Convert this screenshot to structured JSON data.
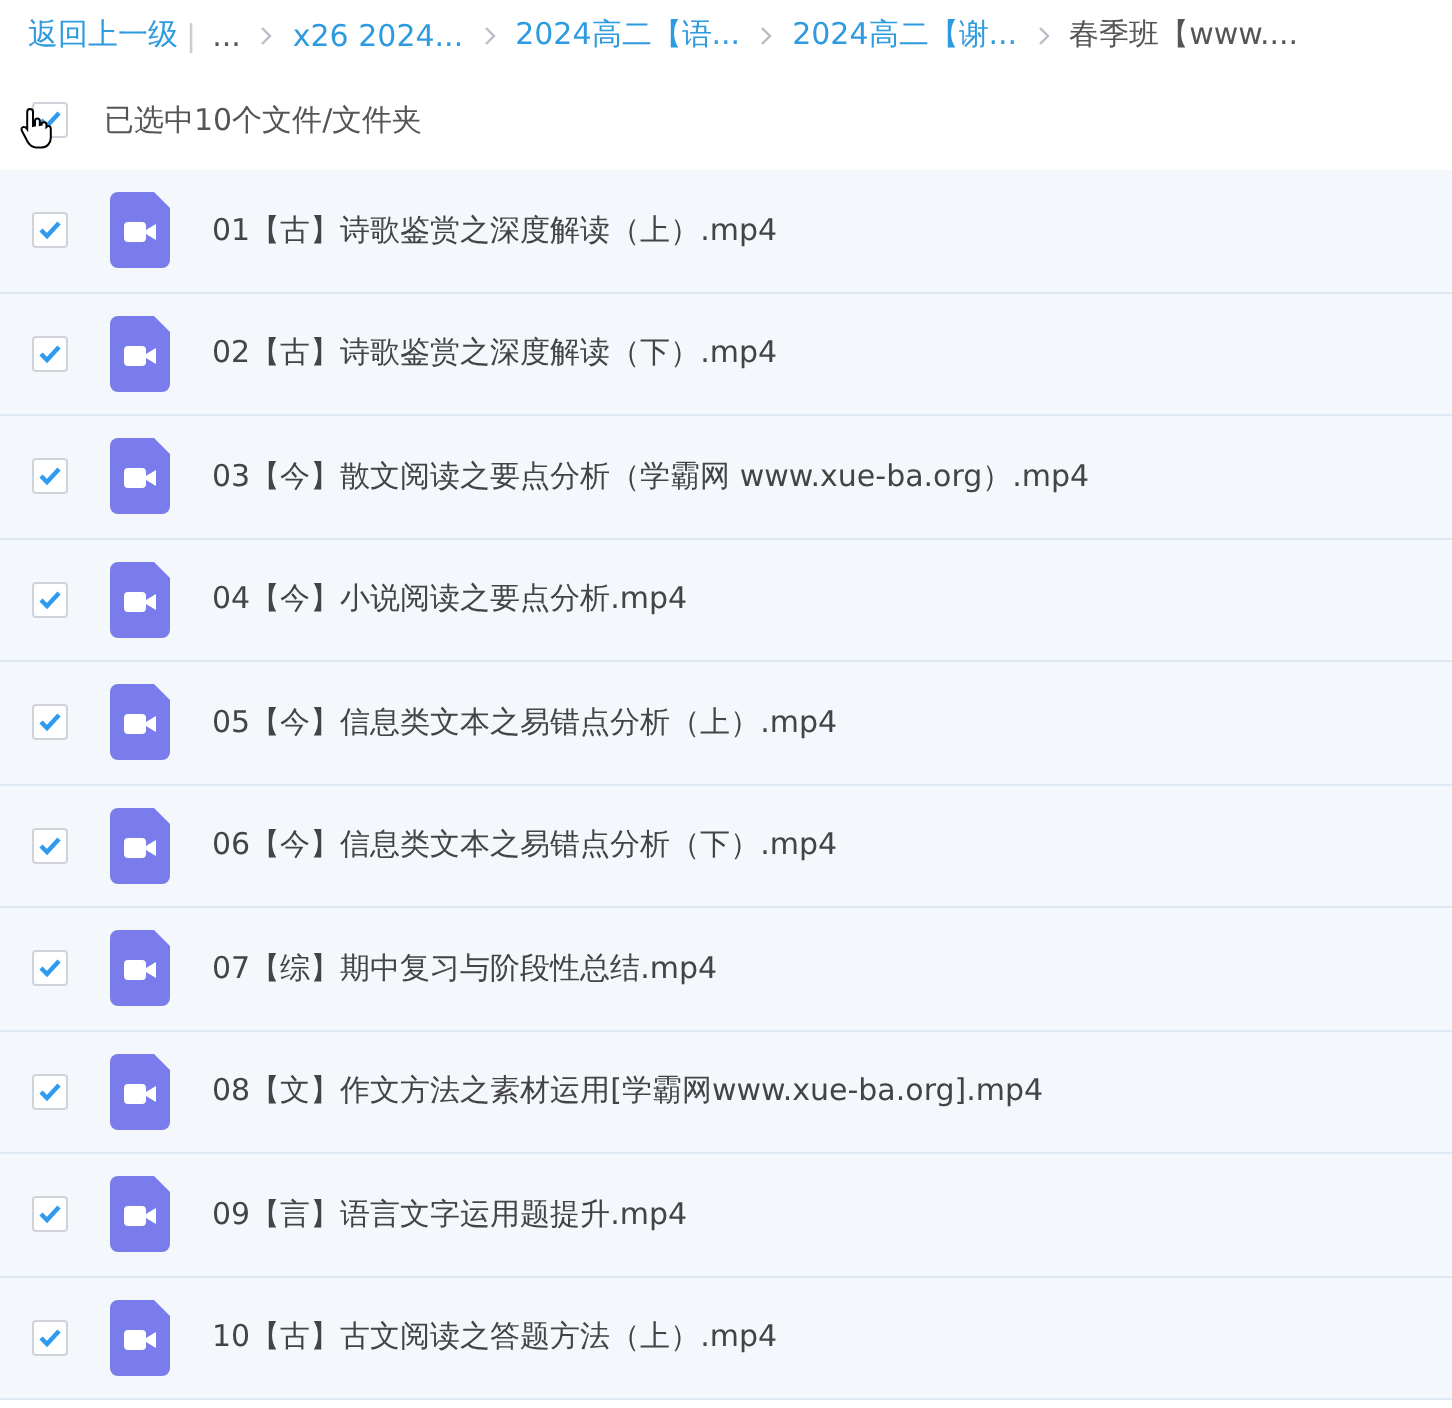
{
  "breadcrumb": {
    "back": "返回上一级",
    "separator": "|",
    "ellipsis": "...",
    "items": [
      {
        "label": "x26 2024...",
        "current": false
      },
      {
        "label": "2024高二【语...",
        "current": false
      },
      {
        "label": "2024高二【谢...",
        "current": false
      },
      {
        "label": "春季班【www....",
        "current": true
      }
    ]
  },
  "select_all": {
    "checked": true,
    "label": "已选中10个文件/文件夹"
  },
  "files": [
    {
      "name": "01【古】诗歌鉴赏之深度解读（上）.mp4",
      "checked": true
    },
    {
      "name": "02【古】诗歌鉴赏之深度解读（下）.mp4",
      "checked": true
    },
    {
      "name": "03【今】散文阅读之要点分析（学霸网 www.xue-ba.org）.mp4",
      "checked": true
    },
    {
      "name": "04【今】小说阅读之要点分析.mp4",
      "checked": true
    },
    {
      "name": "05【今】信息类文本之易错点分析（上）.mp4",
      "checked": true
    },
    {
      "name": "06【今】信息类文本之易错点分析（下）.mp4",
      "checked": true
    },
    {
      "name": "07【综】期中复习与阶段性总结.mp4",
      "checked": true
    },
    {
      "name": "08【文】作文方法之素材运用[学霸网www.xue-ba.org].mp4",
      "checked": true
    },
    {
      "name": "09【言】语言文字运用题提升.mp4",
      "checked": true
    },
    {
      "name": "10【古】古文阅读之答题方法（上）.mp4",
      "checked": true
    }
  ]
}
